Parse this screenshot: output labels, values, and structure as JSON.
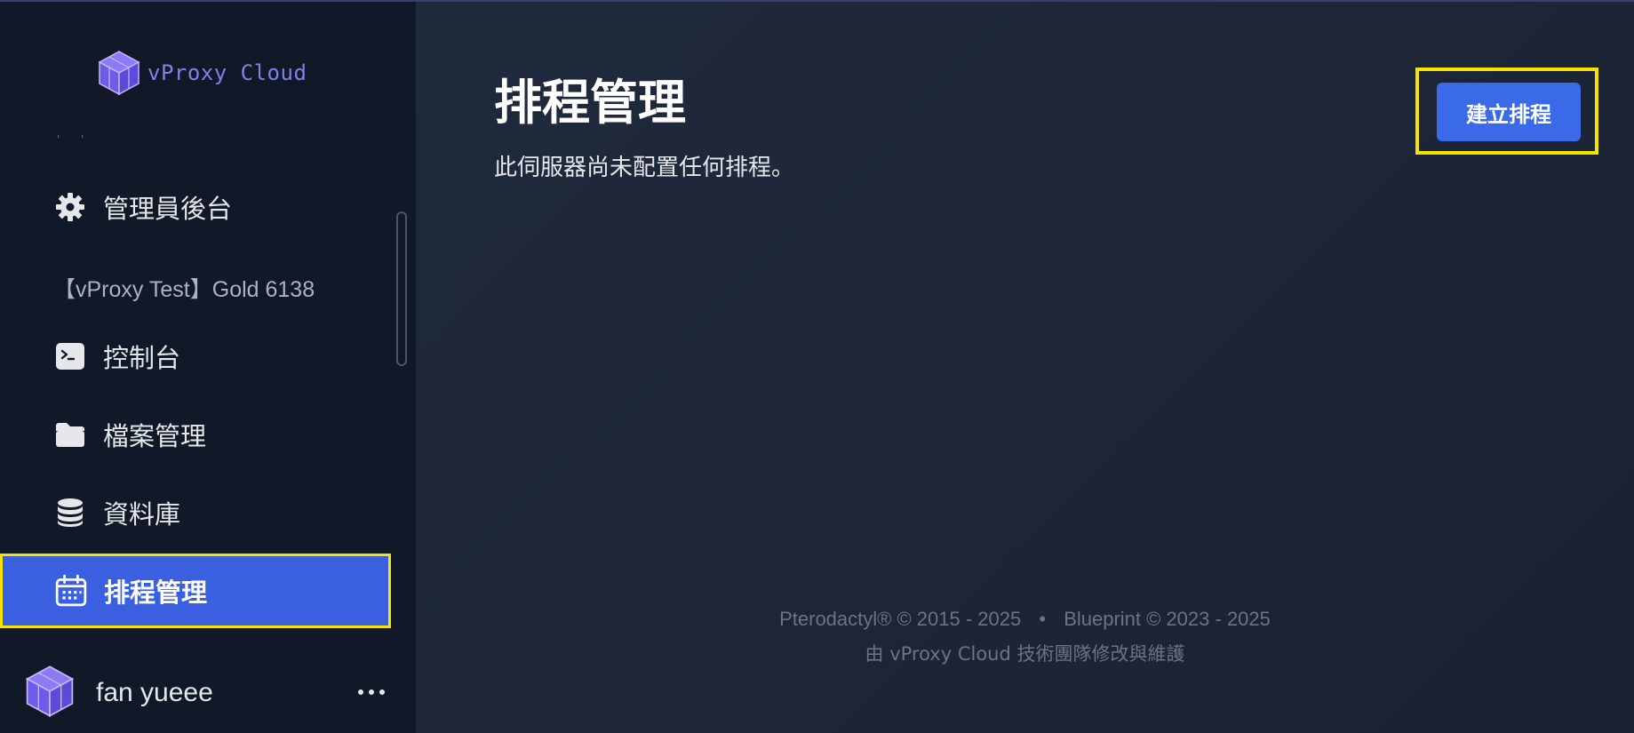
{
  "brand": {
    "name": "vProxy Cloud",
    "accent": "#7c82e6"
  },
  "sidebar": {
    "admin": {
      "label": "管理員後台",
      "icon": "gear-icon"
    },
    "server_name": "【vProxy Test】Gold 6138",
    "items": [
      {
        "label": "控制台",
        "icon": "terminal-icon"
      },
      {
        "label": "檔案管理",
        "icon": "folder-icon"
      },
      {
        "label": "資料庫",
        "icon": "database-icon"
      },
      {
        "label": "排程管理",
        "icon": "calendar-icon",
        "active": true
      }
    ],
    "user": {
      "name": "fan yueee",
      "more_icon": "more-dots-icon"
    }
  },
  "main": {
    "title": "排程管理",
    "subtitle": "此伺服器尚未配置任何排程。",
    "create_button": "建立排程",
    "accent": "#3a6ae8"
  },
  "footer": {
    "pterodactyl": "Pterodactyl® © 2015 - 2025",
    "separator": "•",
    "blueprint": "Blueprint © 2023 - 2025",
    "credit": "由 vProxy Cloud 技術團隊修改與維護"
  },
  "highlight_color": "#f5e400"
}
